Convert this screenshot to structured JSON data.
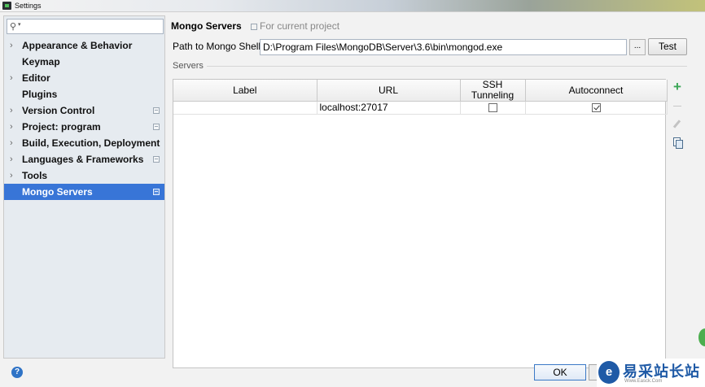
{
  "window": {
    "title": "Settings"
  },
  "search": {
    "placeholder": "",
    "value": ""
  },
  "sidebar": {
    "items": [
      {
        "label": "Appearance & Behavior",
        "expandable": true,
        "project": false
      },
      {
        "label": "Keymap",
        "expandable": false,
        "project": false
      },
      {
        "label": "Editor",
        "expandable": true,
        "project": false
      },
      {
        "label": "Plugins",
        "expandable": false,
        "project": false
      },
      {
        "label": "Version Control",
        "expandable": true,
        "project": true
      },
      {
        "label": "Project: program",
        "expandable": true,
        "project": true
      },
      {
        "label": "Build, Execution, Deployment",
        "expandable": true,
        "project": false
      },
      {
        "label": "Languages & Frameworks",
        "expandable": true,
        "project": true
      },
      {
        "label": "Tools",
        "expandable": true,
        "project": false
      },
      {
        "label": "Mongo Servers",
        "expandable": false,
        "project": true,
        "selected": true
      }
    ]
  },
  "panel": {
    "title": "Mongo Servers",
    "scope": "For current project",
    "shell_label": "Path to Mongo Shell:",
    "shell_path": "D:\\Program Files\\MongoDB\\Server\\3.6\\bin\\mongod.exe",
    "browse_label": "...",
    "test_label": "Test",
    "servers_label": "Servers"
  },
  "table": {
    "columns": [
      "Label",
      "URL",
      "SSH Tunneling",
      "Autoconnect"
    ],
    "rows": [
      {
        "label": "",
        "url": "localhost:27017",
        "ssh_tunneling": false,
        "autoconnect": true
      }
    ]
  },
  "toolbar_icons": [
    "add-icon",
    "remove-icon",
    "edit-icon",
    "copy-icon"
  ],
  "footer": {
    "help": "?",
    "ok_label": "OK"
  },
  "watermark": {
    "logo": "e",
    "text": "易采站长站",
    "sub": "Www.Easck.Com"
  },
  "colors": {
    "selection": "#3875d7",
    "add": "#3aa655",
    "help": "#2f73c6"
  }
}
